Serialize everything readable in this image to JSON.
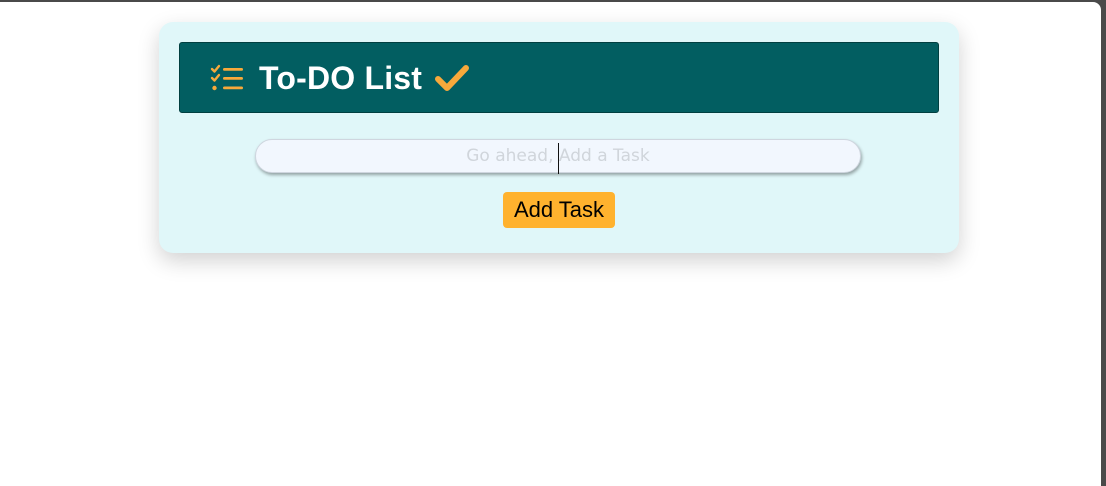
{
  "app": {
    "title": "To-DO List"
  },
  "icons": {
    "list": "checklist-icon",
    "check": "check-icon"
  },
  "input": {
    "placeholder": "Go ahead, Add a Task",
    "value": ""
  },
  "actions": {
    "add_label": "Add Task"
  },
  "colors": {
    "page_background": "#ffffff",
    "card_background": "#e0f7f9",
    "header_background": "#025e61",
    "accent": "#f8a93b",
    "button_background": "#ffb22e",
    "title_text": "#ffffff"
  }
}
